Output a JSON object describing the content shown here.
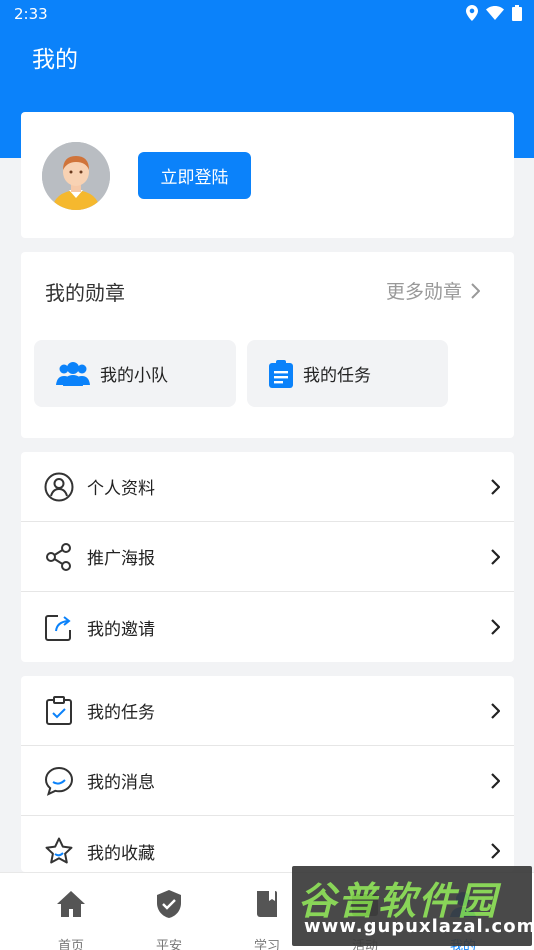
{
  "status": {
    "time": "2:33"
  },
  "header": {
    "title": "我的"
  },
  "profile": {
    "login_label": "立即登陆"
  },
  "medals": {
    "title": "我的勋章",
    "more_label": "更多勋章",
    "buttons": [
      {
        "label": "我的小队",
        "icon": "team-icon"
      },
      {
        "label": "我的任务",
        "icon": "clipboard-icon"
      }
    ]
  },
  "menu_group_1": [
    {
      "label": "个人资料",
      "icon": "user-circle-icon"
    },
    {
      "label": "推广海报",
      "icon": "share-icon"
    },
    {
      "label": "我的邀请",
      "icon": "invite-icon"
    }
  ],
  "menu_group_2": [
    {
      "label": "我的任务",
      "icon": "task-clipboard-icon"
    },
    {
      "label": "我的消息",
      "icon": "message-icon"
    },
    {
      "label": "我的收藏",
      "icon": "star-icon"
    }
  ],
  "tabbar": [
    {
      "label": "首页",
      "icon": "home-icon"
    },
    {
      "label": "平安",
      "icon": "shield-icon"
    },
    {
      "label": "学习",
      "icon": "book-icon"
    },
    {
      "label": "活动",
      "icon": "activity-icon"
    },
    {
      "label": "我的",
      "icon": "profile-icon",
      "active": true
    }
  ],
  "watermark": {
    "title": "谷普软件园",
    "url": "www.gupuxlazal.com"
  },
  "colors": {
    "primary": "#0b82fa",
    "background": "#f2f3f5",
    "card": "#ffffff"
  }
}
